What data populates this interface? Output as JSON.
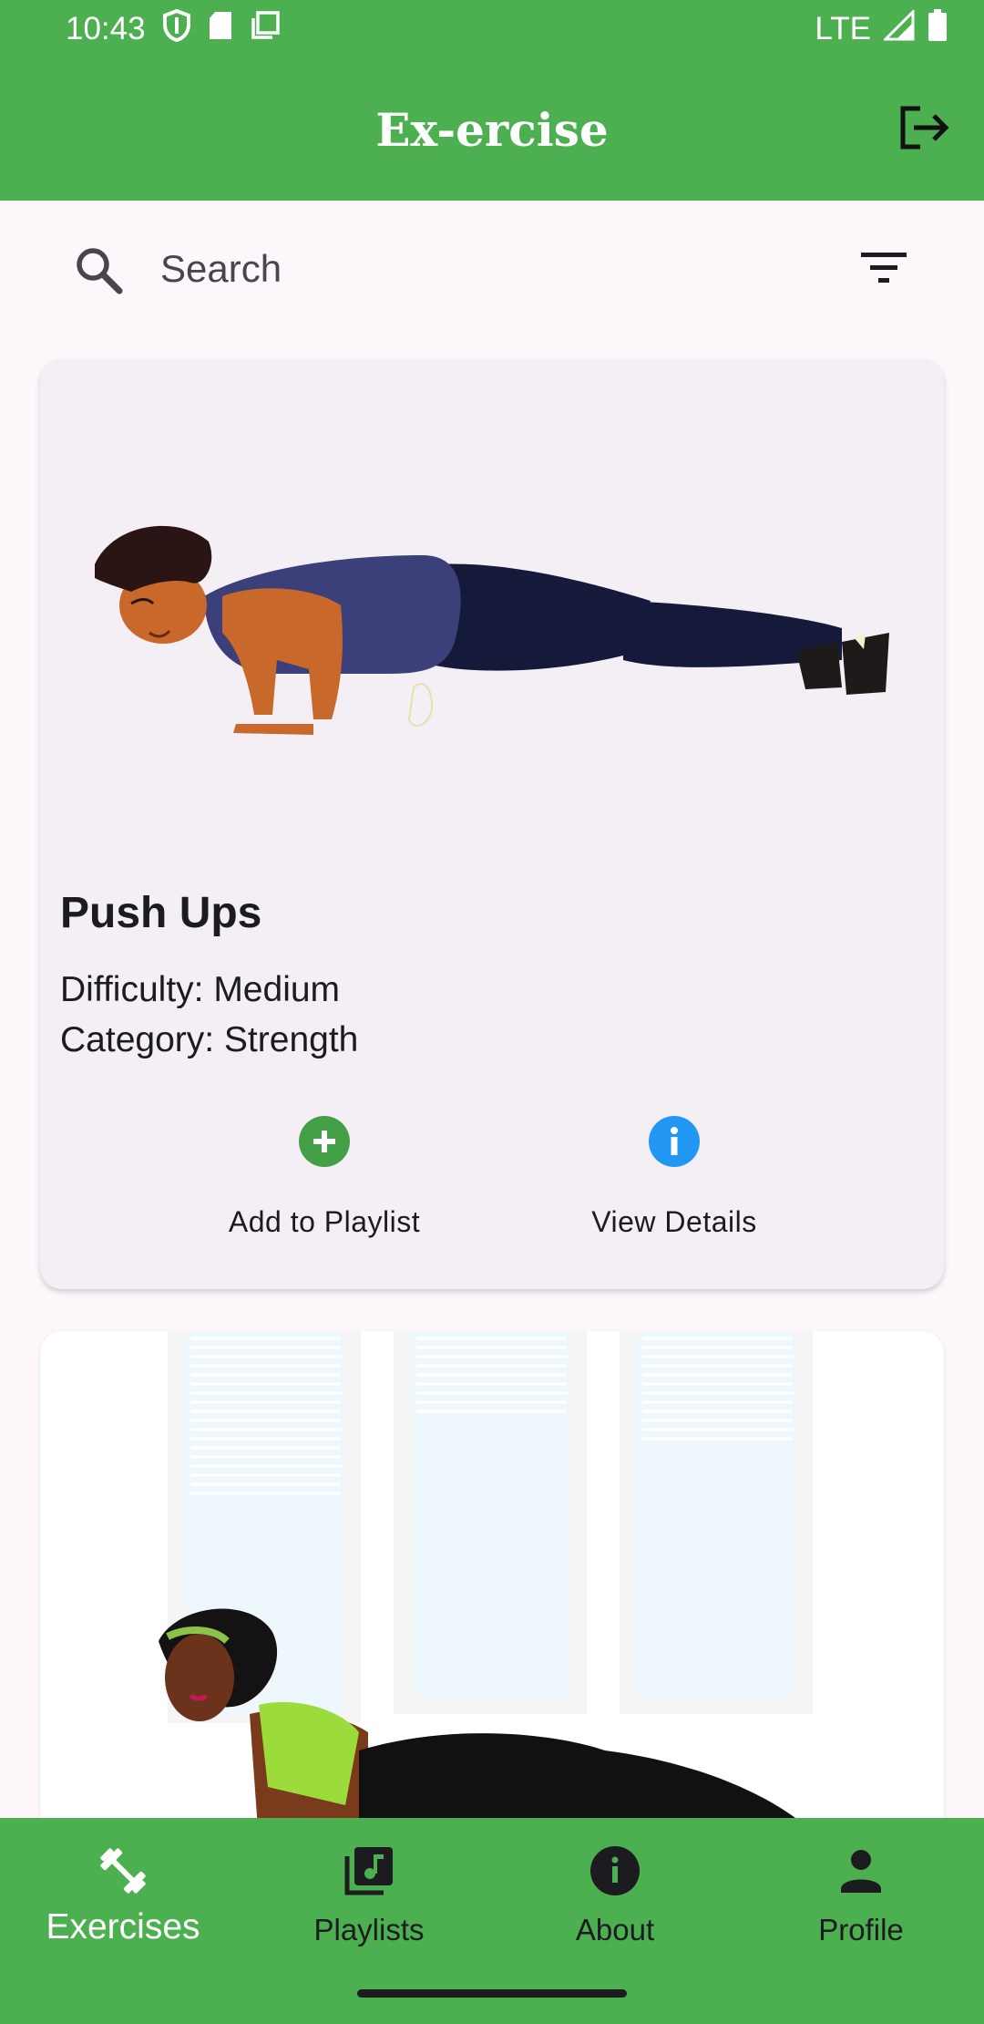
{
  "status_bar": {
    "time": "10:43",
    "network": "LTE",
    "icons": [
      "shield-icon",
      "sd-card-icon",
      "copy-icon",
      "signal-icon",
      "battery-icon"
    ]
  },
  "app_bar": {
    "title": "Ex-ercise",
    "logout_icon": "logout-icon"
  },
  "search": {
    "placeholder": "Search",
    "value": "",
    "filter_icon": "filter-icon"
  },
  "exercises": [
    {
      "title": "Push Ups",
      "difficulty": "Difficulty: Medium",
      "category": "Category: Strength",
      "actions": {
        "add_label": "Add to Playlist",
        "view_label": "View Details"
      }
    }
  ],
  "nav": {
    "items": [
      {
        "label": "Exercises",
        "icon": "dumbbell-icon",
        "active": true
      },
      {
        "label": "Playlists",
        "icon": "music-library-icon",
        "active": false
      },
      {
        "label": "About",
        "icon": "info-icon",
        "active": false
      },
      {
        "label": "Profile",
        "icon": "person-icon",
        "active": false
      }
    ]
  },
  "colors": {
    "primary": "#4caf50",
    "add_icon": "#43a047",
    "info_icon": "#2196f3",
    "background": "#fdf7fb",
    "card": "#f4eff4"
  }
}
